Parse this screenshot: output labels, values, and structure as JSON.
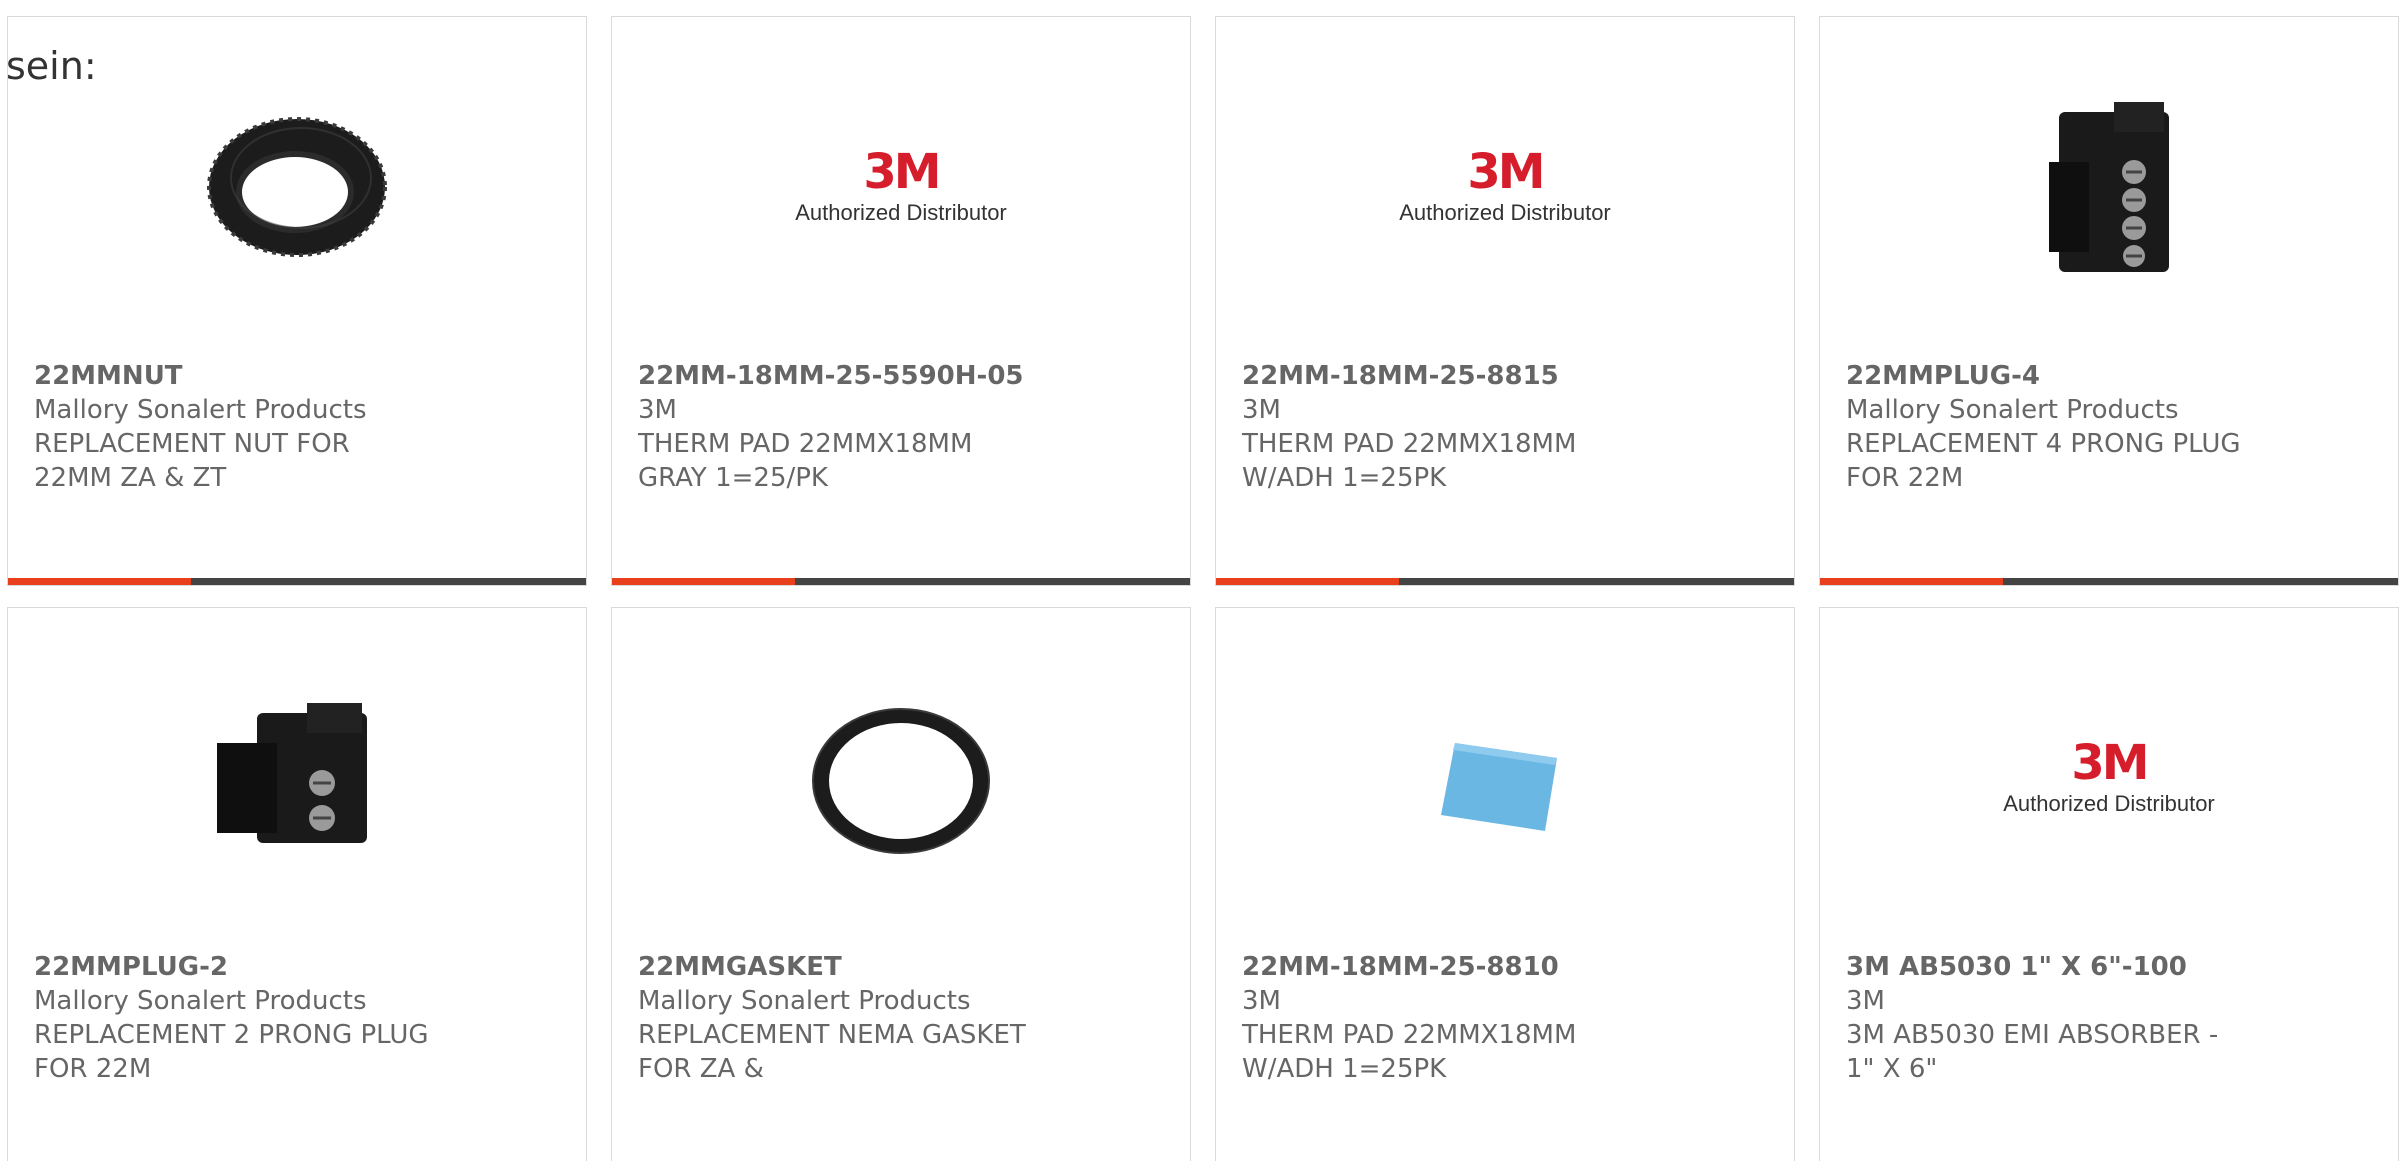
{
  "top_label": "sein:",
  "products": [
    {
      "part": "22MMNUT",
      "brand": "Mallory Sonalert Products",
      "desc": "REPLACEMENT NUT FOR 22MM ZA & ZT",
      "image": "ring-nut-icon"
    },
    {
      "part": "22MM-18MM-25-5590H-05",
      "brand": "3M",
      "desc": "THERM PAD 22MMX18MM GRAY 1=25/PK",
      "image": "3m-logo"
    },
    {
      "part": "22MM-18MM-25-8815",
      "brand": "3M",
      "desc": "THERM PAD 22MMX18MM W/ADH 1=25PK",
      "image": "3m-logo"
    },
    {
      "part": "22MMPLUG-4",
      "brand": "Mallory Sonalert Products",
      "desc": "REPLACEMENT 4 PRONG PLUG FOR 22M",
      "image": "four-prong-plug-icon"
    },
    {
      "part": "22MMPLUG-2",
      "brand": "Mallory Sonalert Products",
      "desc": "REPLACEMENT 2 PRONG PLUG FOR 22M",
      "image": "two-prong-plug-icon"
    },
    {
      "part": "22MMGASKET",
      "brand": "Mallory Sonalert Products",
      "desc": "REPLACEMENT NEMA GASKET FOR ZA &",
      "image": "gasket-icon"
    },
    {
      "part": "22MM-18MM-25-8810",
      "brand": "3M",
      "desc": "THERM PAD 22MMX18MM W/ADH 1=25PK",
      "image": "thermal-pad-icon"
    },
    {
      "part": "3M AB5030 1\" X 6\"-100",
      "brand": "3M",
      "desc": "3M AB5030 EMI ABSORBER - 1\" X 6\"",
      "image": "3m-logo"
    }
  ],
  "logo": {
    "mark": "3M",
    "subtitle": "Authorized Distributor"
  },
  "colors": {
    "accent": "#e8401c",
    "bar": "#444444",
    "logo_red": "#d51d2b"
  }
}
